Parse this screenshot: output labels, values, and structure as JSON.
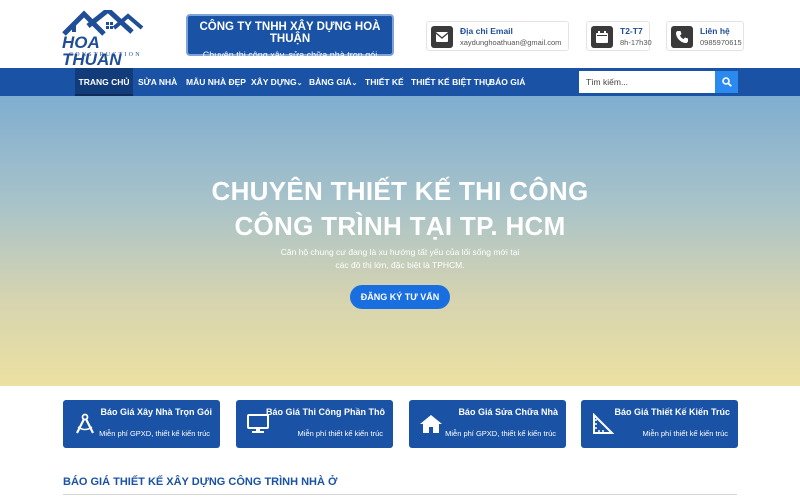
{
  "logo": {
    "text": "HOA THUAN",
    "sub": "CONSTRUCTION"
  },
  "company": {
    "name": "CÔNG TY TNHH XÂY DỰNG HOÀ THUẬN",
    "tagline": "Chuyên thi công xây, sửa chữa nhà trọn gói"
  },
  "contacts": [
    {
      "icon": "mail-icon",
      "title": "Địa chỉ Email",
      "value": "xaydunghoathuan@gmail.com"
    },
    {
      "icon": "calendar-icon",
      "title": "T2-T7",
      "value": "8h-17h30"
    },
    {
      "icon": "phone-icon",
      "title": "Liên hệ",
      "value": "0985970615"
    }
  ],
  "nav": {
    "items": [
      "TRANG CHỦ",
      "SỬA NHÀ",
      "MẪU NHÀ ĐẸP",
      "XÂY DỰNG",
      "BẢNG GIÁ",
      "THIẾT KẾ",
      "THIẾT KẾ BIỆT THỰ",
      "BÁO GIÁ"
    ],
    "active_index": 0,
    "search_placeholder": "Tìm kiếm..."
  },
  "hero": {
    "title_line1": "CHUYÊN THIẾT KẾ THI CÔNG",
    "title_line2": "CÔNG TRÌNH TẠI TP. HCM",
    "subtitle_line1": "Căn hộ chung cư đang là xu hướng tất yếu của lối sống mới tại",
    "subtitle_line2": "các đô thị lớn, đặc biệt là TPHCM.",
    "cta": "ĐĂNG KÝ TƯ VẤN"
  },
  "cards": [
    {
      "icon": "compass-icon",
      "title": "Báo Giá Xây Nhà Trọn Gói",
      "subtitle": "Miễn phí GPXD, thiết kế kiến trúc"
    },
    {
      "icon": "monitor-icon",
      "title": "Báo Giá Thi Công Phần Thô",
      "subtitle": "Miễn phí thiết kế kiến trúc"
    },
    {
      "icon": "home-icon",
      "title": "Báo Giá Sửa Chữa Nhà",
      "subtitle": "Miễn phí GPXD, thiết kế kiến trúc"
    },
    {
      "icon": "ruler-icon",
      "title": "Báo Giá Thiết Kế Kiến Trúc",
      "subtitle": "Miễn phí thiết kế kiến trúc"
    }
  ],
  "section": {
    "title": "BÁO GIÁ THIẾT KẾ XÂY DỰNG CÔNG TRÌNH NHÀ Ở"
  },
  "colors": {
    "primary": "#1a53a5",
    "accent": "#1a6fe0",
    "nav_active": "#123b7a"
  }
}
